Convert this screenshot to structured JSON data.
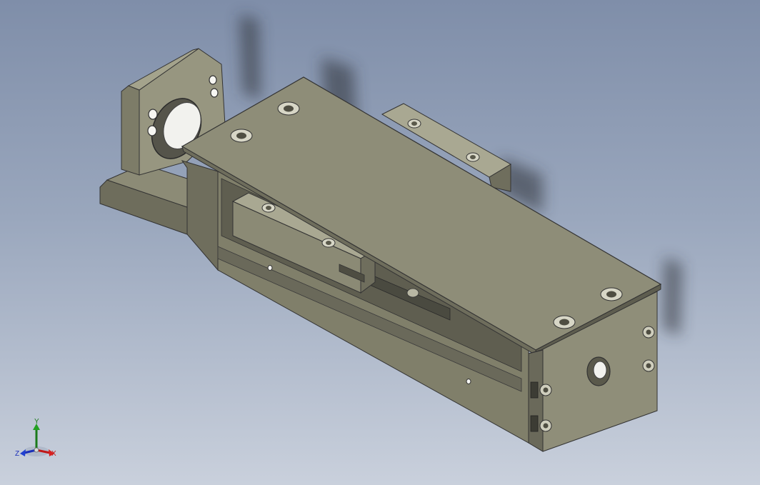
{
  "viewport": {
    "background_top": "#7f8ea9",
    "background_bottom": "#c9d0dc",
    "model_color": "#8e8d78"
  },
  "triad": {
    "x_label": "X",
    "y_label": "Y",
    "z_label": "Z",
    "x_color": "#c01818",
    "y_color": "#1b7a1b",
    "z_color": "#1a2fb8"
  }
}
